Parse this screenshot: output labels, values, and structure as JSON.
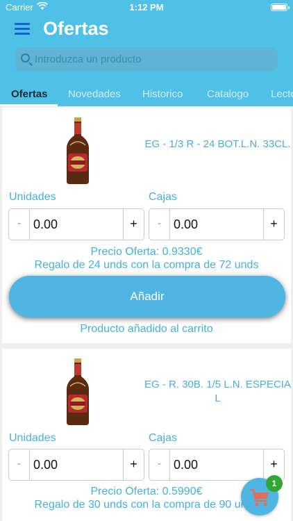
{
  "status_bar": {
    "carrier": "Carrier",
    "time": "1:12 PM"
  },
  "header": {
    "title": "Ofertas",
    "menu_icon": "hamburger-menu-icon"
  },
  "search": {
    "placeholder": "Introduzca un producto",
    "value": ""
  },
  "tabs": [
    {
      "label": "Ofertas",
      "active": true
    },
    {
      "label": "Novedades",
      "active": false
    },
    {
      "label": "Historico",
      "active": false
    },
    {
      "label": "Catalogo",
      "active": false
    },
    {
      "label": "Lecto",
      "active": false
    }
  ],
  "products": [
    {
      "name": "EG - 1/3 R - 24 BOT.L.N. 33CL.",
      "units_label": "Unidades",
      "units_value": "0.00",
      "boxes_label": "Cajas",
      "boxes_value": "0.00",
      "minus": "-",
      "plus": "+",
      "price": "Precio Oferta: 0.9330€",
      "gift": "Regalo de 24 unds con la compra de 72 unds",
      "add_label": "Añadir",
      "added_message": "Producto añadido al carrito"
    },
    {
      "name": "EG - R. 30B. 1/5 L.N. ESPECIAL",
      "units_label": "Unidades",
      "units_value": "0.00",
      "boxes_label": "Cajas",
      "boxes_value": "0.00",
      "minus": "-",
      "plus": "+",
      "price": "Precio Oferta: 0.5990€",
      "gift": "Regalo de 30 unds con la compra de 90 unds"
    }
  ],
  "cart": {
    "badge_count": "1",
    "icon": "shopping-cart-icon"
  },
  "colors": {
    "primary": "#4fc0e6",
    "accent_text": "#45b1d8",
    "badge": "#33a534",
    "menu_icon": "#1b5fd4"
  }
}
